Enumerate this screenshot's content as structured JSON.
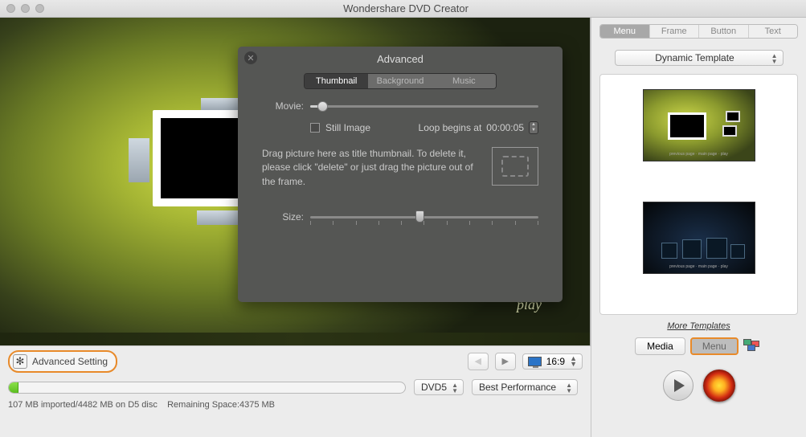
{
  "window": {
    "title": "Wondershare DVD Creator"
  },
  "preview": {
    "play_label": "play"
  },
  "advanced": {
    "title": "Advanced",
    "tabs": {
      "thumbnail": "Thumbnail",
      "background": "Background",
      "music": "Music"
    },
    "movie_label": "Movie:",
    "still_label": "Still Image",
    "loop_label": "Loop begins at",
    "loop_value": "00:00:05",
    "drag_text": "Drag picture here as title thumbnail. To delete it, please click \"delete\" or just drag the picture out of the frame.",
    "size_label": "Size:"
  },
  "toolbar": {
    "advanced_setting": "Advanced Setting",
    "aspect": "16:9"
  },
  "disc": {
    "type": "DVD5",
    "quality": "Best Performance",
    "status_a": "107 MB imported/4482 MB on D5 disc",
    "status_b": "Remaining Space:4375 MB"
  },
  "sidebar": {
    "tabs": {
      "menu": "Menu",
      "frame": "Frame",
      "button": "Button",
      "text": "Text"
    },
    "template_selector": "Dynamic Template",
    "more": "More Templates",
    "media": "Media",
    "menu_btn": "Menu"
  }
}
